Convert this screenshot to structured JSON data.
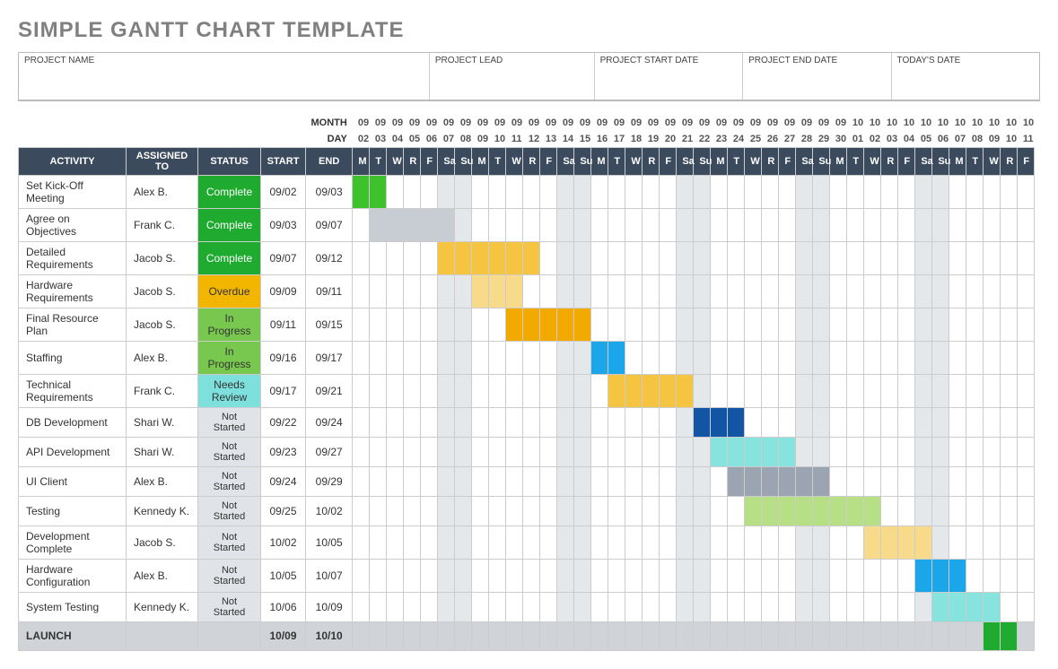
{
  "title": "SIMPLE GANTT CHART TEMPLATE",
  "meta": {
    "project_name_label": "PROJECT NAME",
    "project_lead_label": "PROJECT LEAD",
    "start_date_label": "PROJECT START DATE",
    "end_date_label": "PROJECT END DATE",
    "today_label": "TODAY'S DATE"
  },
  "headers": {
    "month": "MONTH",
    "day": "DAY",
    "activity": "ACTIVITY",
    "assigned_to": "ASSIGNED TO",
    "status": "STATUS",
    "start": "START",
    "end": "END"
  },
  "timeline": {
    "months": [
      "09",
      "09",
      "09",
      "09",
      "09",
      "09",
      "09",
      "09",
      "09",
      "09",
      "09",
      "09",
      "09",
      "09",
      "09",
      "09",
      "09",
      "09",
      "09",
      "09",
      "09",
      "09",
      "09",
      "09",
      "09",
      "09",
      "09",
      "09",
      "09",
      "10",
      "10",
      "10",
      "10",
      "10",
      "10",
      "10",
      "10",
      "10",
      "10",
      "10"
    ],
    "days": [
      "02",
      "03",
      "04",
      "05",
      "06",
      "07",
      "08",
      "09",
      "10",
      "11",
      "12",
      "13",
      "14",
      "15",
      "16",
      "17",
      "18",
      "19",
      "20",
      "21",
      "22",
      "23",
      "24",
      "25",
      "26",
      "27",
      "28",
      "29",
      "30",
      "01",
      "02",
      "03",
      "04",
      "05",
      "06",
      "07",
      "08",
      "09",
      "10",
      "11"
    ],
    "dow": [
      "M",
      "T",
      "W",
      "R",
      "F",
      "Sa",
      "Su",
      "M",
      "T",
      "W",
      "R",
      "F",
      "Sa",
      "Su",
      "M",
      "T",
      "W",
      "R",
      "F",
      "Sa",
      "Su",
      "M",
      "T",
      "W",
      "R",
      "F",
      "Sa",
      "Su",
      "M",
      "T",
      "W",
      "R",
      "F",
      "Sa",
      "Su",
      "M",
      "T",
      "W",
      "R",
      "F"
    ]
  },
  "chart_data": {
    "type": "gantt",
    "x_start": "09/02",
    "x_end": "10/11",
    "tasks": [
      {
        "activity": "Set Kick-Off Meeting",
        "assigned": "Alex B.",
        "status": "Complete",
        "start": "09/02",
        "end": "09/03",
        "bar_color": "#3fc12e"
      },
      {
        "activity": "Agree on Objectives",
        "assigned": "Frank C.",
        "status": "Complete",
        "start": "09/03",
        "end": "09/07",
        "bar_color": "#c8cdd3"
      },
      {
        "activity": "Detailed Requirements",
        "assigned": "Jacob S.",
        "status": "Complete",
        "start": "09/07",
        "end": "09/12",
        "bar_color": "#f5c542"
      },
      {
        "activity": "Hardware Requirements",
        "assigned": "Jacob S.",
        "status": "Overdue",
        "start": "09/09",
        "end": "09/11",
        "bar_color": "#f7da8a"
      },
      {
        "activity": "Final Resource Plan",
        "assigned": "Jacob S.",
        "status": "In Progress",
        "start": "09/11",
        "end": "09/15",
        "bar_color": "#f2a900"
      },
      {
        "activity": "Staffing",
        "assigned": "Alex B.",
        "status": "In Progress",
        "start": "09/16",
        "end": "09/17",
        "bar_color": "#1aa6e8"
      },
      {
        "activity": "Technical Requirements",
        "assigned": "Frank C.",
        "status": "Needs Review",
        "start": "09/17",
        "end": "09/21",
        "bar_color": "#f5c542"
      },
      {
        "activity": "DB Development",
        "assigned": "Shari W.",
        "status": "Not Started",
        "start": "09/22",
        "end": "09/24",
        "bar_color": "#1255a5"
      },
      {
        "activity": "API Development",
        "assigned": "Shari W.",
        "status": "Not Started",
        "start": "09/23",
        "end": "09/27",
        "bar_color": "#86e3de"
      },
      {
        "activity": "UI Client",
        "assigned": "Alex B.",
        "status": "Not Started",
        "start": "09/24",
        "end": "09/29",
        "bar_color": "#9aa5b1"
      },
      {
        "activity": "Testing",
        "assigned": "Kennedy K.",
        "status": "Not Started",
        "start": "09/25",
        "end": "10/02",
        "bar_color": "#b7e086"
      },
      {
        "activity": "Development Complete",
        "assigned": "Jacob S.",
        "status": "Not Started",
        "start": "10/02",
        "end": "10/05",
        "bar_color": "#f7da8a"
      },
      {
        "activity": "Hardware Configuration",
        "assigned": "Alex B.",
        "status": "Not Started",
        "start": "10/05",
        "end": "10/07",
        "bar_color": "#1aa6e8"
      },
      {
        "activity": "System Testing",
        "assigned": "Kennedy K.",
        "status": "Not Started",
        "start": "10/06",
        "end": "10/09",
        "bar_color": "#86e3de"
      },
      {
        "activity": "LAUNCH",
        "assigned": "",
        "status": "",
        "start": "10/09",
        "end": "10/10",
        "bar_color": "#1eab2f",
        "is_launch": true
      }
    ],
    "status_styles": {
      "Complete": "st-complete",
      "Overdue": "st-overdue",
      "In Progress": "st-inprogress",
      "Needs Review": "st-review",
      "Not Started": "st-notstarted"
    }
  }
}
